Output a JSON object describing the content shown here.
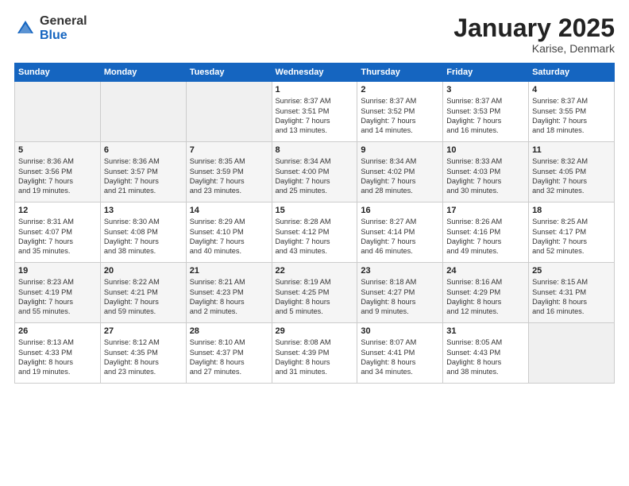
{
  "header": {
    "logo_general": "General",
    "logo_blue": "Blue",
    "title": "January 2025",
    "subtitle": "Karise, Denmark"
  },
  "weekdays": [
    "Sunday",
    "Monday",
    "Tuesday",
    "Wednesday",
    "Thursday",
    "Friday",
    "Saturday"
  ],
  "weeks": [
    [
      {
        "day": "",
        "detail": ""
      },
      {
        "day": "",
        "detail": ""
      },
      {
        "day": "",
        "detail": ""
      },
      {
        "day": "1",
        "detail": "Sunrise: 8:37 AM\nSunset: 3:51 PM\nDaylight: 7 hours\nand 13 minutes."
      },
      {
        "day": "2",
        "detail": "Sunrise: 8:37 AM\nSunset: 3:52 PM\nDaylight: 7 hours\nand 14 minutes."
      },
      {
        "day": "3",
        "detail": "Sunrise: 8:37 AM\nSunset: 3:53 PM\nDaylight: 7 hours\nand 16 minutes."
      },
      {
        "day": "4",
        "detail": "Sunrise: 8:37 AM\nSunset: 3:55 PM\nDaylight: 7 hours\nand 18 minutes."
      }
    ],
    [
      {
        "day": "5",
        "detail": "Sunrise: 8:36 AM\nSunset: 3:56 PM\nDaylight: 7 hours\nand 19 minutes."
      },
      {
        "day": "6",
        "detail": "Sunrise: 8:36 AM\nSunset: 3:57 PM\nDaylight: 7 hours\nand 21 minutes."
      },
      {
        "day": "7",
        "detail": "Sunrise: 8:35 AM\nSunset: 3:59 PM\nDaylight: 7 hours\nand 23 minutes."
      },
      {
        "day": "8",
        "detail": "Sunrise: 8:34 AM\nSunset: 4:00 PM\nDaylight: 7 hours\nand 25 minutes."
      },
      {
        "day": "9",
        "detail": "Sunrise: 8:34 AM\nSunset: 4:02 PM\nDaylight: 7 hours\nand 28 minutes."
      },
      {
        "day": "10",
        "detail": "Sunrise: 8:33 AM\nSunset: 4:03 PM\nDaylight: 7 hours\nand 30 minutes."
      },
      {
        "day": "11",
        "detail": "Sunrise: 8:32 AM\nSunset: 4:05 PM\nDaylight: 7 hours\nand 32 minutes."
      }
    ],
    [
      {
        "day": "12",
        "detail": "Sunrise: 8:31 AM\nSunset: 4:07 PM\nDaylight: 7 hours\nand 35 minutes."
      },
      {
        "day": "13",
        "detail": "Sunrise: 8:30 AM\nSunset: 4:08 PM\nDaylight: 7 hours\nand 38 minutes."
      },
      {
        "day": "14",
        "detail": "Sunrise: 8:29 AM\nSunset: 4:10 PM\nDaylight: 7 hours\nand 40 minutes."
      },
      {
        "day": "15",
        "detail": "Sunrise: 8:28 AM\nSunset: 4:12 PM\nDaylight: 7 hours\nand 43 minutes."
      },
      {
        "day": "16",
        "detail": "Sunrise: 8:27 AM\nSunset: 4:14 PM\nDaylight: 7 hours\nand 46 minutes."
      },
      {
        "day": "17",
        "detail": "Sunrise: 8:26 AM\nSunset: 4:16 PM\nDaylight: 7 hours\nand 49 minutes."
      },
      {
        "day": "18",
        "detail": "Sunrise: 8:25 AM\nSunset: 4:17 PM\nDaylight: 7 hours\nand 52 minutes."
      }
    ],
    [
      {
        "day": "19",
        "detail": "Sunrise: 8:23 AM\nSunset: 4:19 PM\nDaylight: 7 hours\nand 55 minutes."
      },
      {
        "day": "20",
        "detail": "Sunrise: 8:22 AM\nSunset: 4:21 PM\nDaylight: 7 hours\nand 59 minutes."
      },
      {
        "day": "21",
        "detail": "Sunrise: 8:21 AM\nSunset: 4:23 PM\nDaylight: 8 hours\nand 2 minutes."
      },
      {
        "day": "22",
        "detail": "Sunrise: 8:19 AM\nSunset: 4:25 PM\nDaylight: 8 hours\nand 5 minutes."
      },
      {
        "day": "23",
        "detail": "Sunrise: 8:18 AM\nSunset: 4:27 PM\nDaylight: 8 hours\nand 9 minutes."
      },
      {
        "day": "24",
        "detail": "Sunrise: 8:16 AM\nSunset: 4:29 PM\nDaylight: 8 hours\nand 12 minutes."
      },
      {
        "day": "25",
        "detail": "Sunrise: 8:15 AM\nSunset: 4:31 PM\nDaylight: 8 hours\nand 16 minutes."
      }
    ],
    [
      {
        "day": "26",
        "detail": "Sunrise: 8:13 AM\nSunset: 4:33 PM\nDaylight: 8 hours\nand 19 minutes."
      },
      {
        "day": "27",
        "detail": "Sunrise: 8:12 AM\nSunset: 4:35 PM\nDaylight: 8 hours\nand 23 minutes."
      },
      {
        "day": "28",
        "detail": "Sunrise: 8:10 AM\nSunset: 4:37 PM\nDaylight: 8 hours\nand 27 minutes."
      },
      {
        "day": "29",
        "detail": "Sunrise: 8:08 AM\nSunset: 4:39 PM\nDaylight: 8 hours\nand 31 minutes."
      },
      {
        "day": "30",
        "detail": "Sunrise: 8:07 AM\nSunset: 4:41 PM\nDaylight: 8 hours\nand 34 minutes."
      },
      {
        "day": "31",
        "detail": "Sunrise: 8:05 AM\nSunset: 4:43 PM\nDaylight: 8 hours\nand 38 minutes."
      },
      {
        "day": "",
        "detail": ""
      }
    ]
  ]
}
